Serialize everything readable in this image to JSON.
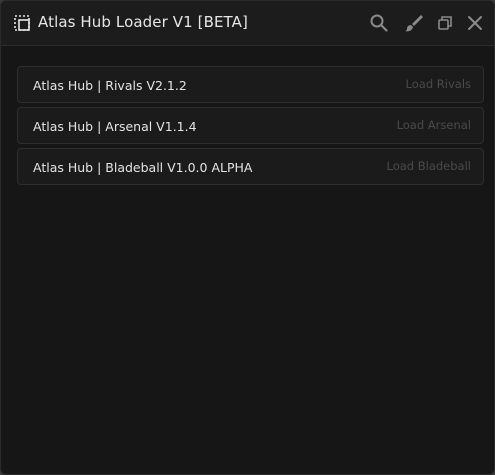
{
  "window": {
    "title": "Atlas Hub Loader V1 [BETA]"
  },
  "titlebar": {
    "icons": [
      "grid-icon",
      "search-icon",
      "brush-icon",
      "restore-icon",
      "close-icon"
    ]
  },
  "scripts": [
    {
      "label": "Atlas Hub | Rivals V2.1.2",
      "action": "Load Rivals"
    },
    {
      "label": "Atlas Hub | Arsenal V1.1.4",
      "action": "Load Arsenal"
    },
    {
      "label": "Atlas Hub | Bladeball V1.0.0 ALPHA",
      "action": "Load Bladeball"
    }
  ],
  "colors": {
    "background": "#161616",
    "row_background": "#1b1b1b",
    "text": "#e4e4e4",
    "muted": "#4a4a4a"
  }
}
